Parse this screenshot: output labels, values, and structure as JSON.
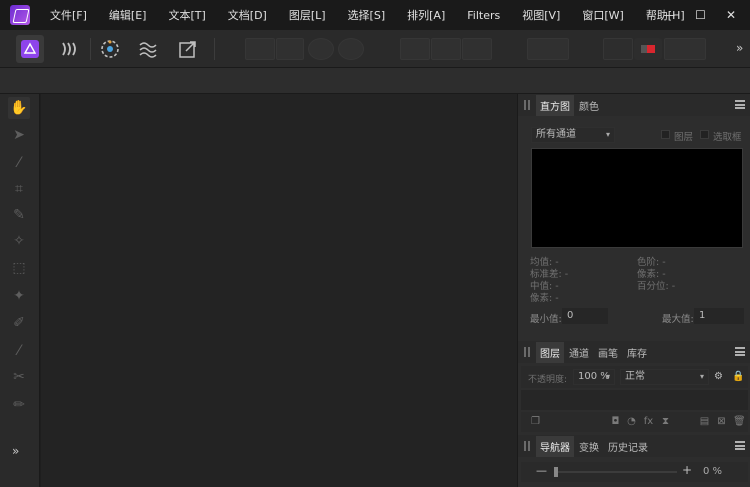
{
  "menu": [
    "文件[F]",
    "编辑[E]",
    "文本[T]",
    "文档[D]",
    "图层[L]",
    "选择[S]",
    "排列[A]",
    "Filters",
    "视图[V]",
    "窗口[W]",
    "帮助[H]"
  ],
  "window_controls": {
    "minimize": "—",
    "maximize": "☐",
    "close": "✕"
  },
  "toolbar": {
    "personas": [
      "photo-persona-icon",
      "liquify-persona-icon",
      "develop-persona-icon",
      "tone-mapping-persona-icon",
      "export-persona-icon"
    ],
    "overflow": "»"
  },
  "tools": {
    "items": [
      "hand-tool-icon",
      "move-tool-icon",
      "color-picker-icon",
      "crop-tool-icon",
      "selection-brush-icon",
      "flood-select-icon",
      "marquee-icon",
      "freehand-select-icon",
      "paint-brush-icon",
      "pixel-tool-icon",
      "erase-brush-icon",
      "clone-brush-icon"
    ],
    "expand": "»"
  },
  "histogram": {
    "tabs": [
      "直方图",
      "颜色"
    ],
    "channel": "所有通道",
    "chk_layer": "图层",
    "chk_selection": "选取框",
    "stats_left": [
      "均值: -",
      "标准差: -",
      "中值: -",
      "像素: -"
    ],
    "stats_right": [
      "色阶: -",
      "像素: -",
      "百分位: -"
    ],
    "min_label": "最小值:",
    "min_value": "0",
    "max_label": "最大值:",
    "max_value": "1"
  },
  "layers": {
    "tabs": [
      "图层",
      "通道",
      "画笔",
      "库存"
    ],
    "opacity_label": "不透明度:",
    "opacity_value": "100 %",
    "blend_mode": "正常"
  },
  "navigator": {
    "tabs": [
      "导航器",
      "变换",
      "历史记录"
    ],
    "zoom_minus": "—",
    "zoom_plus": "+",
    "zoom_value": "0 %"
  },
  "colors": {
    "accent": "#8e44ec",
    "panel": "#2d2d2d",
    "canvas": "#232323"
  }
}
